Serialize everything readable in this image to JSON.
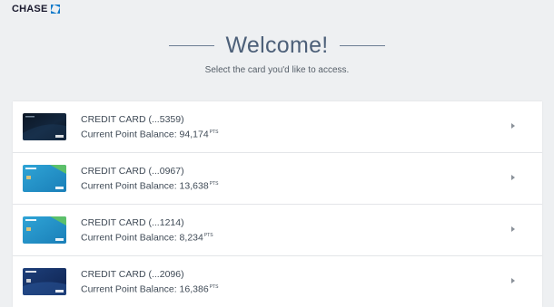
{
  "header": {
    "logo_text": "CHASE"
  },
  "welcome": {
    "title": "Welcome!",
    "subtitle": "Select the card you'd like to access."
  },
  "cards": [
    {
      "name": "CREDIT CARD (...5359)",
      "points_label": "Current Point Balance: 94,174",
      "points_unit": "PTS",
      "art": "sapphire-reserve"
    },
    {
      "name": "CREDIT CARD (...0967)",
      "points_label": "Current Point Balance: 13,638",
      "points_unit": "PTS",
      "art": "freedom"
    },
    {
      "name": "CREDIT CARD (...1214)",
      "points_label": "Current Point Balance: 8,234",
      "points_unit": "PTS",
      "art": "freedom"
    },
    {
      "name": "CREDIT CARD (...2096)",
      "points_label": "Current Point Balance: 16,386",
      "points_unit": "PTS",
      "art": "freedom-unlimited"
    }
  ],
  "colors": {
    "background": "#eef0f2",
    "title": "#4d6079",
    "brand": "#117aca"
  }
}
